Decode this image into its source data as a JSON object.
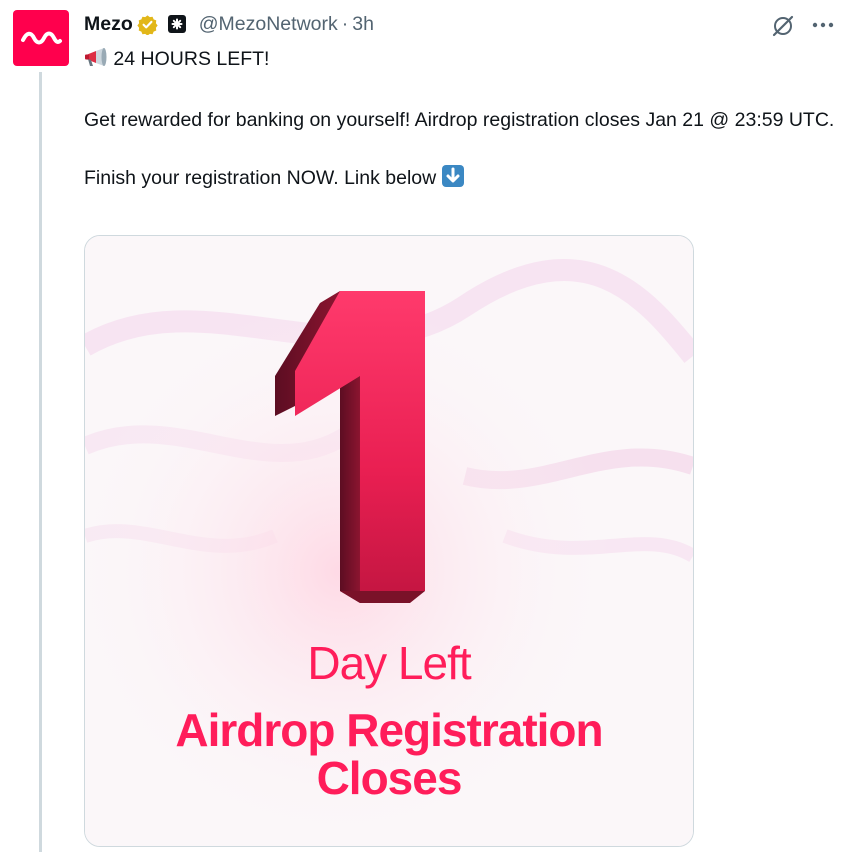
{
  "author": {
    "display_name": "Mezo",
    "handle": "@MezoNetwork",
    "separator": "·",
    "time": "3h"
  },
  "icons": {
    "avatar": "mezo-logo",
    "verified": "gold-verified-badge",
    "affiliate": "affiliate-badge",
    "grok": "grok-icon",
    "more": "more-icon",
    "megaphone": "megaphone-emoji",
    "down_arrow": "down-arrow-emoji"
  },
  "tweet": {
    "line1": "24 HOURS LEFT!",
    "line2": "Get rewarded for banking on yourself! Airdrop registration closes Jan 21 @ 23:59 UTC.",
    "line3": "Finish your registration NOW. Link below"
  },
  "media": {
    "number": "1",
    "day_left": "Day Left",
    "title_line1": "Airdrop Registration",
    "title_line2": "Closes"
  },
  "colors": {
    "brand": "#ff004d",
    "accent_text": "#ff1d5a",
    "verified_gold": "#e2b719"
  }
}
